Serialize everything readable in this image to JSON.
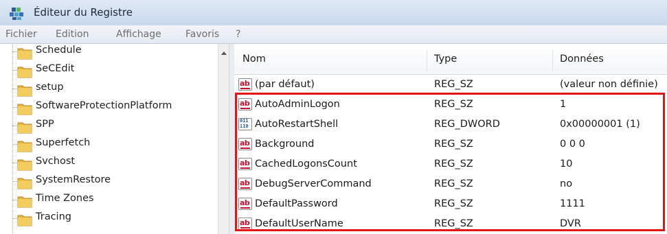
{
  "window": {
    "title": "Éditeur du Registre"
  },
  "menu": [
    "Fichier",
    "Edition",
    "Affichage",
    "Favoris",
    "?"
  ],
  "tree": {
    "items": [
      "Schedule",
      "SeCEdit",
      "setup",
      "SoftwareProtectionPlatform",
      "SPP",
      "Superfetch",
      "Svchost",
      "SystemRestore",
      "Time Zones",
      "Tracing"
    ]
  },
  "list": {
    "columns": [
      "Nom",
      "Type",
      "Données"
    ],
    "rows": [
      {
        "icon": "string-value-icon",
        "name": "(par défaut)",
        "type": "REG_SZ",
        "data": "(valeur non définie)"
      },
      {
        "icon": "string-value-icon",
        "name": "AutoAdminLogon",
        "type": "REG_SZ",
        "data": "1"
      },
      {
        "icon": "binary-value-icon",
        "name": "AutoRestartShell",
        "type": "REG_DWORD",
        "data": "0x00000001 (1)"
      },
      {
        "icon": "string-value-icon",
        "name": "Background",
        "type": "REG_SZ",
        "data": "0 0 0"
      },
      {
        "icon": "string-value-icon",
        "name": "CachedLogonsCount",
        "type": "REG_SZ",
        "data": "10"
      },
      {
        "icon": "string-value-icon",
        "name": "DebugServerCommand",
        "type": "REG_SZ",
        "data": "no"
      },
      {
        "icon": "string-value-icon",
        "name": "DefaultPassword",
        "type": "REG_SZ",
        "data": "1111"
      },
      {
        "icon": "string-value-icon",
        "name": "DefaultUserName",
        "type": "REG_SZ",
        "data": "DVR"
      }
    ]
  },
  "colors": {
    "highlight": "#e41414",
    "folder": "#e8b53c",
    "string_icon": "#c8102e",
    "dword_icon": "#1c5fb8"
  }
}
